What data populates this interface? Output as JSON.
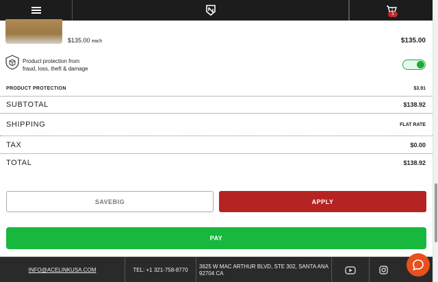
{
  "topbar": {
    "menu_icon": "hamburger-menu-icon",
    "logo_icon": "brand-shield-logo-icon",
    "cart_icon": "shopping-cart-icon",
    "cart_count": "1",
    "cart_inner_count": "1"
  },
  "product": {
    "unit_price": "$135.00",
    "each_label": "each",
    "line_total": "$135.00"
  },
  "protection": {
    "text_line1": "Product protection from",
    "text_line2": "fraud, loss, theft & damage",
    "toggle_on": true,
    "label": "PRODUCT PROTECTION",
    "value": "$3.91"
  },
  "summary": {
    "subtotal_label": "SUBTOTAL",
    "subtotal_value": "$138.92",
    "shipping_label": "SHIPPING",
    "shipping_value": "FLAT RATE",
    "tax_label": "TAX",
    "tax_value": "$0.00",
    "total_label": "TOTAL",
    "total_value": "$138.92"
  },
  "coupon": {
    "value": "SAVEBIG",
    "apply_label": "APPLY"
  },
  "pay_label": "PAY",
  "footer": {
    "email": "INFO@ACELINKUSA.COM",
    "tel": "TEL: +1 321-758-8770",
    "address_line1": "3625 W MAC ARTHUR BLVD, STE 302, SANTA ANA",
    "address_line2": "92704 CA"
  },
  "colors": {
    "topbar_bg": "#1c1c1c",
    "apply_red": "#b52323",
    "pay_green": "#17b83d",
    "toggle_green": "#1faa3a",
    "chat_orange": "#e8501d"
  }
}
